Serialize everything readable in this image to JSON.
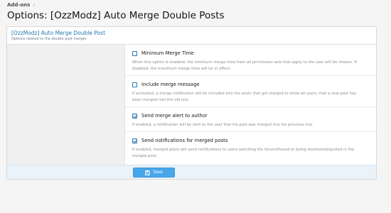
{
  "breadcrumb": {
    "item": "Add-ons"
  },
  "page": {
    "title": "Options: [OzzModz] Auto Merge Double Posts"
  },
  "block": {
    "title": "[OzzModz] Auto Merge Double Post",
    "description": "Options related to the double post merger."
  },
  "options": [
    {
      "label": "Minimum Merge Time",
      "checked": false,
      "hint": "When this option is enabled, the minimum merge time from all permission sets that apply to the user will be chosen. If disabled, the maximum merge time will be in effect."
    },
    {
      "label": "Include merge message",
      "checked": false,
      "hint": "If activated, a merge notification will be included into the posts that got merged to show all users, that a new post has been merged into the old one."
    },
    {
      "label": "Send merge alert to author",
      "checked": true,
      "hint": "If enabled, a notification will be sent to the user that his post was merged into his previous one."
    },
    {
      "label": "Send notifications for merged posts",
      "checked": true,
      "hint": "If enabled, merged posts will send notifications to users watching the forum/thread or being mentioned/quoted in the merged post."
    }
  ],
  "submit": {
    "save_label": "Save",
    "icon": "save-icon"
  },
  "colors": {
    "accent": "#2577b1",
    "button": "#47a7eb",
    "submit_bg": "#eaf2fa"
  }
}
